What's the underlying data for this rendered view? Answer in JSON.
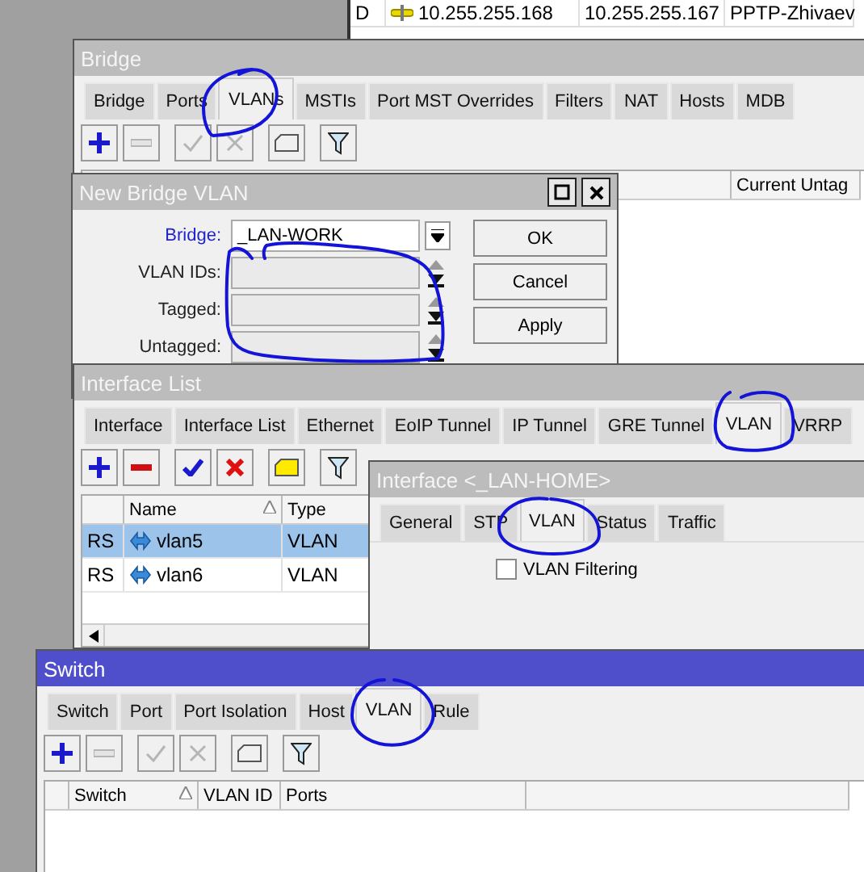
{
  "background_list": {
    "rows": [
      {
        "flag": "D",
        "address": "10.255.255.168",
        "network": "10.255.255.167",
        "interface": "PPTP-Zhivaev"
      }
    ]
  },
  "bridge": {
    "title": "Bridge",
    "active": false,
    "tabs": [
      {
        "label": "Bridge",
        "selected": false
      },
      {
        "label": "Ports",
        "selected": false
      },
      {
        "label": "VLANs",
        "selected": true
      },
      {
        "label": "MSTIs",
        "selected": false
      },
      {
        "label": "Port MST Overrides",
        "selected": false
      },
      {
        "label": "Filters",
        "selected": false
      },
      {
        "label": "NAT",
        "selected": false
      },
      {
        "label": "Hosts",
        "selected": false
      },
      {
        "label": "MDB",
        "selected": false
      }
    ],
    "toolbar": [
      {
        "kind": "add",
        "disabled": false
      },
      {
        "kind": "remove",
        "disabled": true
      },
      {
        "kind": "enable",
        "disabled": true
      },
      {
        "kind": "disable",
        "disabled": true
      },
      {
        "kind": "comment",
        "disabled": true
      },
      {
        "kind": "filter",
        "disabled": false
      }
    ],
    "columns": [
      "Current Untag"
    ]
  },
  "new_bridge_vlan": {
    "title": "New Bridge VLAN",
    "active": false,
    "fields": [
      {
        "label": "Bridge:",
        "kind": "dropdown",
        "value": "_LAN-WORK",
        "link": true
      },
      {
        "label": "VLAN IDs:",
        "kind": "spin",
        "link": false
      },
      {
        "label": "Tagged:",
        "kind": "spin",
        "link": false
      },
      {
        "label": "Untagged:",
        "kind": "spin",
        "link": false
      }
    ],
    "buttons": [
      "OK",
      "Cancel",
      "Apply"
    ]
  },
  "interface_list": {
    "title": "Interface List",
    "active": false,
    "tabs": [
      {
        "label": "Interface",
        "selected": false
      },
      {
        "label": "Interface List",
        "selected": false
      },
      {
        "label": "Ethernet",
        "selected": false
      },
      {
        "label": "EoIP Tunnel",
        "selected": false
      },
      {
        "label": "IP Tunnel",
        "selected": false
      },
      {
        "label": "GRE Tunnel",
        "selected": false
      },
      {
        "label": "VLAN",
        "selected": true
      },
      {
        "label": "VRRP",
        "selected": false
      }
    ],
    "toolbar": [
      {
        "kind": "add",
        "disabled": false
      },
      {
        "kind": "remove",
        "disabled": false
      },
      {
        "kind": "enable",
        "disabled": false
      },
      {
        "kind": "disable",
        "disabled": false
      },
      {
        "kind": "comment",
        "disabled": false
      },
      {
        "kind": "filter",
        "disabled": false
      }
    ],
    "columns": [
      {
        "sorted": false
      },
      {
        "label": "Name",
        "sorted": true
      },
      {
        "label": "Type",
        "sorted": false
      }
    ],
    "rows": [
      {
        "flag": "RS",
        "name": "vlan5",
        "type": "VLAN",
        "selected": true
      },
      {
        "flag": "RS",
        "name": "vlan6",
        "type": "VLAN",
        "selected": false
      }
    ]
  },
  "interface_window": {
    "title": "Interface <_LAN-HOME>",
    "active": false,
    "tabs": [
      {
        "label": "General",
        "selected": false
      },
      {
        "label": "STP",
        "selected": false
      },
      {
        "label": "VLAN",
        "selected": true
      },
      {
        "label": "Status",
        "selected": false
      },
      {
        "label": "Traffic",
        "selected": false
      }
    ],
    "vlan_filtering": {
      "label": "VLAN Filtering",
      "checked": false
    }
  },
  "switch": {
    "title": "Switch",
    "active": true,
    "tabs": [
      {
        "label": "Switch",
        "selected": false
      },
      {
        "label": "Port",
        "selected": false
      },
      {
        "label": "Port Isolation",
        "selected": false
      },
      {
        "label": "Host",
        "selected": false
      },
      {
        "label": "VLAN",
        "selected": true
      },
      {
        "label": "Rule",
        "selected": false
      }
    ],
    "toolbar": [
      {
        "kind": "add",
        "disabled": false
      },
      {
        "kind": "remove",
        "disabled": true
      },
      {
        "kind": "enable",
        "disabled": true
      },
      {
        "kind": "disable",
        "disabled": true
      },
      {
        "kind": "comment",
        "disabled": true
      },
      {
        "kind": "filter",
        "disabled": false
      }
    ],
    "columns": [
      {
        "sorted": false
      },
      {
        "label": "Switch",
        "sorted": true
      },
      {
        "label": "VLAN ID",
        "sorted": false
      },
      {
        "label": "Ports",
        "sorted": false
      }
    ]
  }
}
